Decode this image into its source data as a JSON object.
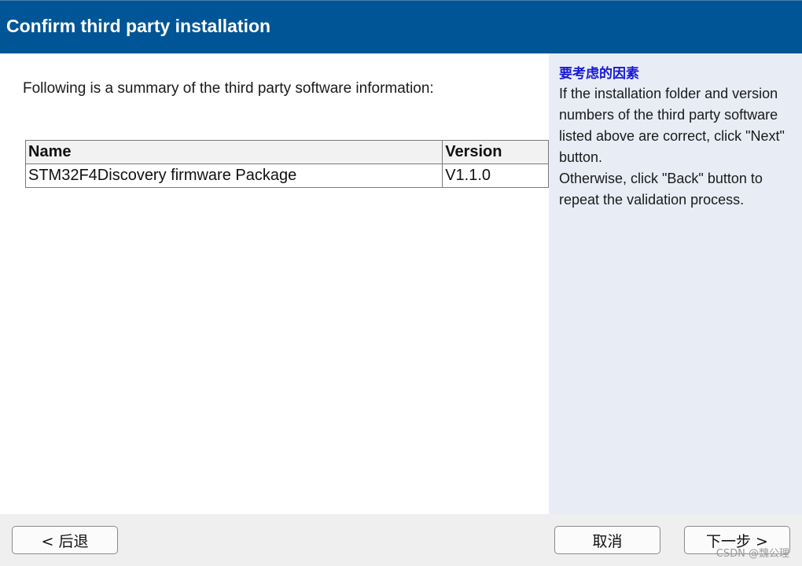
{
  "window": {
    "title": "Confirm third party installation"
  },
  "main": {
    "summary_text": "Following is a summary of the third party software information:",
    "table": {
      "headers": [
        "Name",
        "Version"
      ],
      "rows": [
        [
          "STM32F4Discovery firmware Package",
          "V1.1.0"
        ]
      ]
    }
  },
  "help": {
    "title": "要考虑的因素",
    "paragraph_1": "If the installation folder and version numbers of the third party software listed above are correct, click \"Next\" button.",
    "paragraph_2": "Otherwise, click \"Back\" button to repeat the validation process."
  },
  "footer": {
    "back_label": "< 后退",
    "cancel_label": "取消",
    "next_label": "下一步 >"
  },
  "watermark": "CSDN @魏公理",
  "colors": {
    "header_bg": "#005596",
    "help_bg": "#e8edf5",
    "help_title": "#1919d9",
    "footer_bg": "#efefef"
  }
}
